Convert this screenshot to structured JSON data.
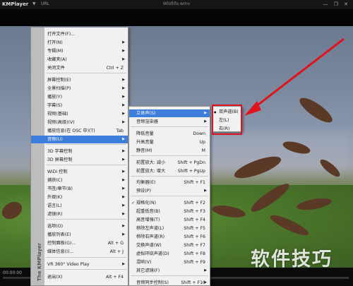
{
  "titlebar": {
    "app_name": "KMPlayer",
    "menu_glyph": "▼",
    "url_label": "URL",
    "file_name": "Wildlife.wmv",
    "window_buttons": "— ❐ ✕"
  },
  "statusbar": {
    "time": "00:00:00",
    "progress_fraction": 0.0
  },
  "watermark": "软件技巧",
  "main_menu": {
    "sidebar_text": "The KMPlayer",
    "items": [
      {
        "label": "打开文件(F)...",
        "shortcut": "",
        "submenu": false
      },
      {
        "label": "打开(N)",
        "shortcut": "",
        "submenu": true
      },
      {
        "label": "专辑(M)",
        "shortcut": "",
        "submenu": true
      },
      {
        "label": "收藏夹(A)",
        "shortcut": "",
        "submenu": true
      },
      {
        "label": "关闭文件",
        "shortcut": "Ctrl + Z",
        "submenu": false
      },
      {
        "label": "屏幕控制(E)",
        "shortcut": "",
        "submenu": true
      },
      {
        "label": "全景扫描(P)",
        "shortcut": "",
        "submenu": true
      },
      {
        "label": "播放(Y)",
        "shortcut": "",
        "submenu": true
      },
      {
        "label": "字幕(S)",
        "shortcut": "",
        "submenu": true
      },
      {
        "label": "视频(基础)",
        "shortcut": "",
        "submenu": true
      },
      {
        "label": "视频(高级)(V)",
        "shortcut": "",
        "submenu": true
      },
      {
        "label": "播放信息(在 OSC 中)(T)",
        "shortcut": "Tab",
        "submenu": false
      },
      {
        "label": "音频(U)",
        "shortcut": "",
        "submenu": true,
        "highlight": true
      },
      {
        "label": "3D 字幕控制",
        "shortcut": "",
        "submenu": true
      },
      {
        "label": "3D 屏幕控制",
        "shortcut": "",
        "submenu": true
      },
      {
        "label": "WiDi 控制",
        "shortcut": "",
        "submenu": true
      },
      {
        "label": "捕获(C)",
        "shortcut": "",
        "submenu": true
      },
      {
        "label": "书签/章节(B)",
        "shortcut": "",
        "submenu": true
      },
      {
        "label": "外观(K)",
        "shortcut": "",
        "submenu": true
      },
      {
        "label": "语言(L)",
        "shortcut": "",
        "submenu": true
      },
      {
        "label": "滤镜(R)",
        "shortcut": "",
        "submenu": true
      },
      {
        "label": "选项(O)",
        "shortcut": "",
        "submenu": true
      },
      {
        "label": "播放列表(E)",
        "shortcut": "",
        "submenu": true
      },
      {
        "label": "控制面板(G)...",
        "shortcut": "Alt + G",
        "submenu": false
      },
      {
        "label": "媒体信息(I)...",
        "shortcut": "Alt + J",
        "submenu": false
      },
      {
        "label": "VR 360° Video Play",
        "shortcut": "",
        "submenu": true
      },
      {
        "label": "退出(X)",
        "shortcut": "Alt + F4",
        "submenu": false
      }
    ]
  },
  "audio_menu": {
    "items": [
      {
        "label": "立体声(S)",
        "shortcut": "",
        "submenu": true,
        "highlight": true
      },
      {
        "label": "音频渲染器",
        "shortcut": "",
        "submenu": true
      },
      {
        "label": "降低音量",
        "shortcut": "Down",
        "submenu": false
      },
      {
        "label": "升高音量",
        "shortcut": "Up",
        "submenu": false
      },
      {
        "label": "静音(M)",
        "shortcut": "M",
        "submenu": false
      },
      {
        "label": "前置放大: 减小",
        "shortcut": "Shift + PgDn",
        "submenu": false
      },
      {
        "label": "前置放大: 增大",
        "shortcut": "Shift + PgUp",
        "submenu": false
      },
      {
        "label": "均衡器(E)",
        "shortcut": "Shift + F1",
        "submenu": false
      },
      {
        "label": "预设(P)",
        "shortcut": "",
        "submenu": true
      },
      {
        "label": "规格化(N)",
        "shortcut": "Shift + F2",
        "submenu": false,
        "checked": true
      },
      {
        "label": "超重低音(B)",
        "shortcut": "Shift + F3",
        "submenu": false
      },
      {
        "label": "高音增强(T)",
        "shortcut": "Shift + F4",
        "submenu": false
      },
      {
        "label": "移除左声道(L)",
        "shortcut": "Shift + F5",
        "submenu": false
      },
      {
        "label": "移除右声道(R)",
        "shortcut": "Shift + F6",
        "submenu": false
      },
      {
        "label": "交换声道(W)",
        "shortcut": "Shift + F7",
        "submenu": false
      },
      {
        "label": "虚拟环绕声道(D)",
        "shortcut": "Shift + F8",
        "submenu": false
      },
      {
        "label": "混响(V)",
        "shortcut": "Shift + F9",
        "submenu": false
      },
      {
        "label": "其它滤镜(F)",
        "shortcut": "",
        "submenu": true
      },
      {
        "label": "音频同步控制(S)",
        "shortcut": "Shift + F10",
        "submenu": true
      }
    ]
  },
  "stereo_menu": {
    "items": [
      {
        "label": "双声道(B)",
        "selected": true
      },
      {
        "label": "左(L)",
        "selected": false
      },
      {
        "label": "右(R)",
        "selected": false
      }
    ]
  },
  "colors": {
    "highlight": "#3d7ddb",
    "annotation_red": "#e0141e"
  }
}
